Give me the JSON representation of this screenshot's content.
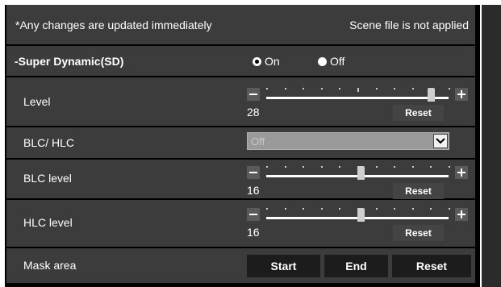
{
  "header": {
    "note": "*Any changes are updated immediately",
    "scene_status": "Scene file is not applied"
  },
  "super_dynamic": {
    "title": "-Super Dynamic(SD)",
    "on_label": "On",
    "off_label": "Off",
    "selected": "On"
  },
  "level": {
    "label": "Level",
    "value": "28",
    "reset_label": "Reset",
    "min": 0,
    "max": 31,
    "position": 28
  },
  "blc_hlc": {
    "label": "BLC/ HLC",
    "selected": "Off"
  },
  "blc_level": {
    "label": "BLC level",
    "value": "16",
    "reset_label": "Reset",
    "min": 0,
    "max": 31,
    "position": 16
  },
  "hlc_level": {
    "label": "HLC level",
    "value": "16",
    "reset_label": "Reset",
    "min": 0,
    "max": 31,
    "position": 16
  },
  "mask_area": {
    "label": "Mask area",
    "start_label": "Start",
    "end_label": "End",
    "reset_label": "Reset"
  },
  "colors": {
    "panel": "#3c3c3c",
    "background": "#000000",
    "text": "#ffffff"
  }
}
